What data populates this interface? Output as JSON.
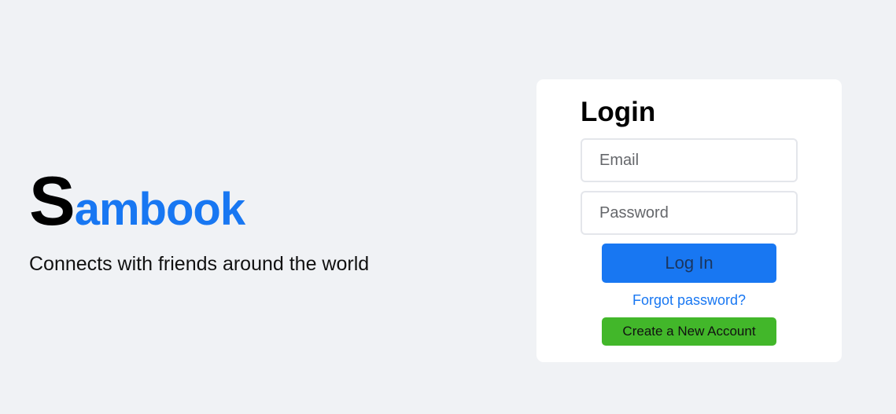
{
  "brand": {
    "logo_initial": "S",
    "logo_rest": "ambook",
    "tagline": "Connects with friends around the world"
  },
  "login": {
    "title": "Login",
    "email_placeholder": "Email",
    "password_placeholder": "Password",
    "login_button": "Log In",
    "forgot_link": "Forgot password?",
    "create_button": "Create a New Account"
  },
  "colors": {
    "background": "#f0f2f5",
    "brand_blue": "#1877f2",
    "create_green": "#42b72a",
    "card": "#ffffff"
  }
}
